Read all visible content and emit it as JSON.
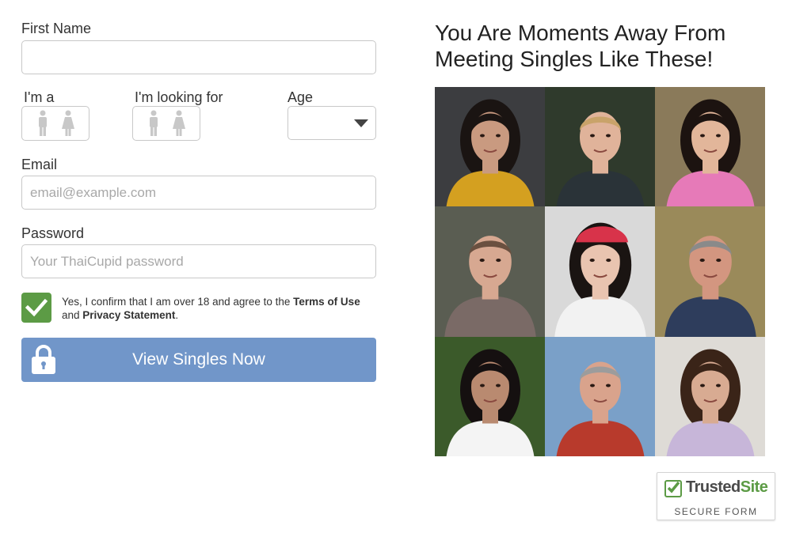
{
  "form": {
    "first_name_label": "First Name",
    "first_name_value": "",
    "im_a_label": "I'm a",
    "looking_for_label": "I'm looking for",
    "age_label": "Age",
    "age_value": "",
    "email_label": "Email",
    "email_placeholder": "email@example.com",
    "password_label": "Password",
    "password_placeholder": "Your ThaiCupid password",
    "consent_text_1": "Yes, I confirm that I am over 18 and agree to the ",
    "terms_link": "Terms of Use",
    "consent_text_2": " and ",
    "privacy_link": "Privacy Statement",
    "consent_text_3": ".",
    "consent_checked": true,
    "submit_label": "View Singles Now"
  },
  "promo": {
    "headline_line1": "You Are Moments Away From",
    "headline_line2": "Meeting Singles Like These!",
    "photos": [
      {
        "icon": "woman-photo",
        "bg": "#3c3d40",
        "shirt": "#d4a020",
        "hair": "#1a1412",
        "skin": "#c99a80"
      },
      {
        "icon": "man-photo",
        "bg": "#2f3a2c",
        "shirt": "#2a3338",
        "hair": "#c9a36a",
        "skin": "#e0b39a"
      },
      {
        "icon": "woman-photo",
        "bg": "#8a7a5a",
        "shirt": "#e67ab8",
        "hair": "#1c1310",
        "skin": "#e2b69a"
      },
      {
        "icon": "man-photo",
        "bg": "#5a5d52",
        "shirt": "#7a6a66",
        "hair": "#6a5040",
        "skin": "#d7a891"
      },
      {
        "icon": "woman-photo",
        "bg": "#d9d9d9",
        "shirt": "#f2f2f2",
        "hair": "#1a1412",
        "skin": "#e9c4b0",
        "hat": "#d8334a"
      },
      {
        "icon": "man-photo",
        "bg": "#9a8a5a",
        "shirt": "#2e3d5c",
        "hair": "#8a8a8a",
        "skin": "#d39680"
      },
      {
        "icon": "woman-photo",
        "bg": "#3b5a2a",
        "shirt": "#f4f4f4",
        "hair": "#151010",
        "skin": "#b98a70"
      },
      {
        "icon": "man-photo",
        "bg": "#7aa0c8",
        "shirt": "#b83a2c",
        "hair": "#9c9c9c",
        "skin": "#d9a38c"
      },
      {
        "icon": "woman-photo",
        "bg": "#dedbd6",
        "shirt": "#c7b6d9",
        "hair": "#3a2418",
        "skin": "#d8ab92"
      }
    ]
  },
  "badge": {
    "brand_trusted": "Trusted",
    "brand_site": "Site",
    "subtitle": "SECURE FORM"
  },
  "colors": {
    "checkbox_green": "#5c9b45",
    "button_blue": "#7196c9",
    "field_border": "#c8c8c8"
  }
}
